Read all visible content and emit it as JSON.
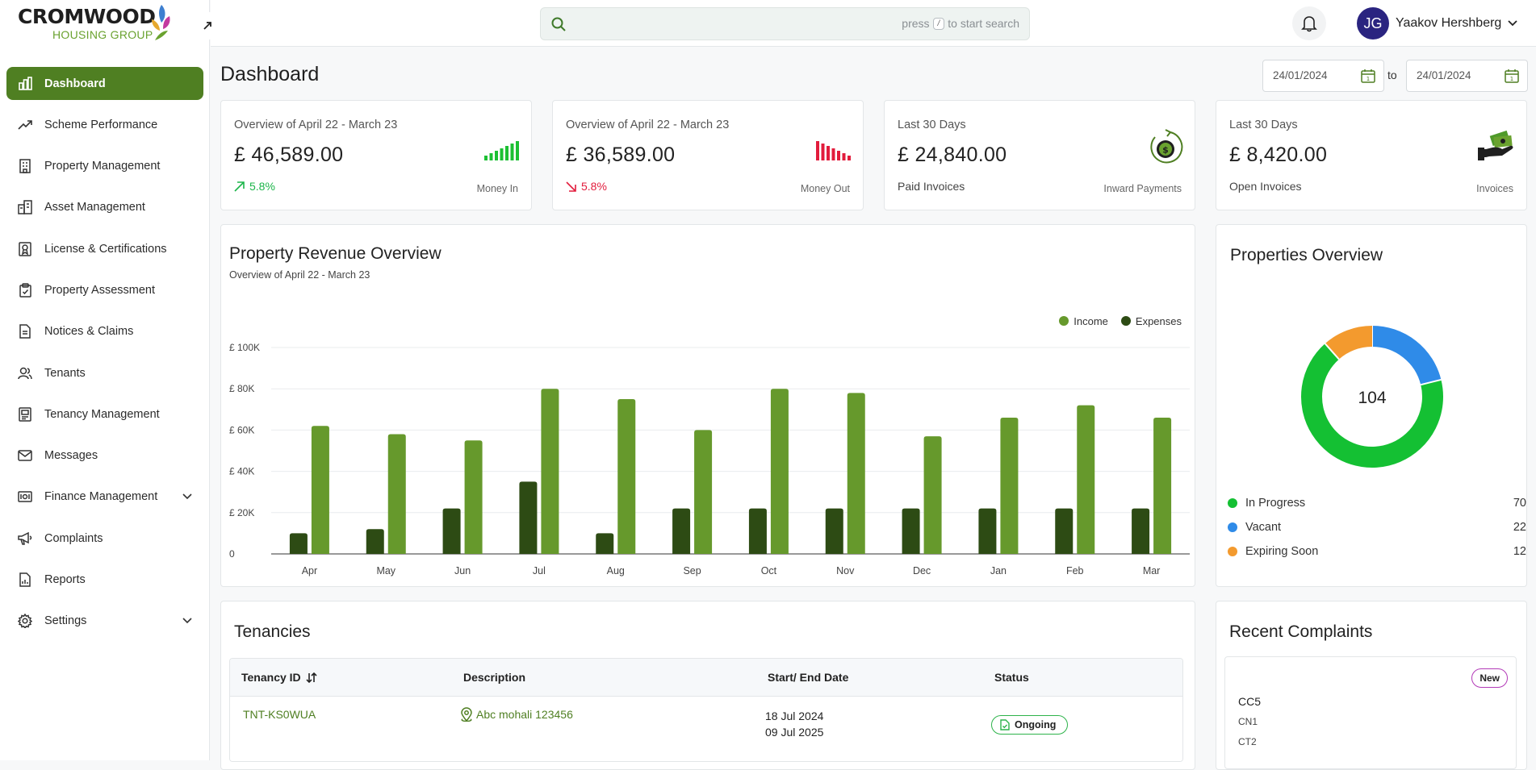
{
  "brand": {
    "line1": "CROMWOOD",
    "line2": "HOUSING GROUP"
  },
  "sidebar": {
    "items": [
      {
        "label": "Dashboard",
        "icon": "bar-chart-icon"
      },
      {
        "label": "Scheme Performance",
        "icon": "trend-up-icon"
      },
      {
        "label": "Property Management",
        "icon": "building-icon"
      },
      {
        "label": "Asset Management",
        "icon": "buildings-icon"
      },
      {
        "label": "License & Certifications",
        "icon": "certificate-icon"
      },
      {
        "label": "Property Assessment",
        "icon": "clipboard-check-icon"
      },
      {
        "label": "Notices & Claims",
        "icon": "document-icon"
      },
      {
        "label": "Tenants",
        "icon": "users-icon"
      },
      {
        "label": "Tenancy Management",
        "icon": "tenancy-icon"
      },
      {
        "label": "Messages",
        "icon": "mail-icon"
      },
      {
        "label": "Finance Management",
        "icon": "finance-icon"
      },
      {
        "label": "Complaints",
        "icon": "megaphone-icon"
      },
      {
        "label": "Reports",
        "icon": "report-icon"
      },
      {
        "label": "Settings",
        "icon": "gear-icon"
      }
    ]
  },
  "search": {
    "hint_before": "press",
    "hint_key": "/",
    "hint_after": "to start search"
  },
  "user": {
    "name": "Yaakov Hershberg",
    "initials": "JG"
  },
  "page": {
    "title": "Dashboard",
    "date_from": "24/01/2024",
    "date_to_label": "to",
    "date_to": "24/01/2024"
  },
  "stats": [
    {
      "label": "Overview of April 22 - March 23",
      "amount": "£ 46,589.00",
      "change": "5.8%",
      "caption": "Money In"
    },
    {
      "label": "Overview of April 22 - March 23",
      "amount": "£ 36,589.00",
      "change": "5.8%",
      "caption": "Money Out"
    },
    {
      "label": "Last 30 Days",
      "amount": "£ 24,840.00",
      "sub": "Paid Invoices",
      "caption": "Inward Payments"
    },
    {
      "label": "Last 30 Days",
      "amount": "£ 8,420.00",
      "sub": "Open Invoices",
      "caption": "Invoices"
    }
  ],
  "revenue": {
    "title": "Property Revenue Overview",
    "subtitle": "Overview of April 22 - March 23"
  },
  "chart_data": {
    "type": "bar",
    "categories": [
      "Apr",
      "May",
      "Jun",
      "Jul",
      "Aug",
      "Sep",
      "Oct",
      "Nov",
      "Dec",
      "Jan",
      "Feb",
      "Mar"
    ],
    "series": [
      {
        "name": "Expenses",
        "color": "#2d4b14",
        "values": [
          10000,
          12000,
          22000,
          35000,
          10000,
          22000,
          22000,
          22000,
          22000,
          22000,
          22000,
          22000
        ]
      },
      {
        "name": "Income",
        "color": "#66992c",
        "values": [
          62000,
          58000,
          55000,
          80000,
          75000,
          60000,
          80000,
          78000,
          57000,
          66000,
          72000,
          66000
        ]
      }
    ],
    "yticks": [
      "0",
      "£ 20K",
      "£ 40K",
      "£ 60K",
      "£ 80K",
      "£ 100K"
    ],
    "ylim": [
      0,
      100000
    ],
    "legend": [
      "Income",
      "Expenses"
    ],
    "legend_position": "top-right"
  },
  "properties": {
    "title": "Properties Overview",
    "total": "104",
    "items": [
      {
        "label": "In Progress",
        "value": 70,
        "color": "#14c033"
      },
      {
        "label": "Vacant",
        "value": 22,
        "color": "#2f8be8"
      },
      {
        "label": "Expiring Soon",
        "value": 12,
        "color": "#f39a2e"
      }
    ]
  },
  "tenancies": {
    "title": "Tenancies",
    "headers": {
      "id": "Tenancy ID",
      "description": "Description",
      "dates": "Start/ End Date",
      "status": "Status"
    },
    "rows": [
      {
        "id": "TNT-KS0WUA",
        "description": "Abc mohali 123456",
        "start": "18 Jul 2024",
        "end": "09 Jul 2025",
        "status": "Ongoing"
      }
    ]
  },
  "complaints": {
    "title": "Recent Complaints",
    "items": [
      {
        "badge": "New",
        "code": "CC5",
        "line1": "CN1",
        "line2": "CT2"
      }
    ]
  }
}
